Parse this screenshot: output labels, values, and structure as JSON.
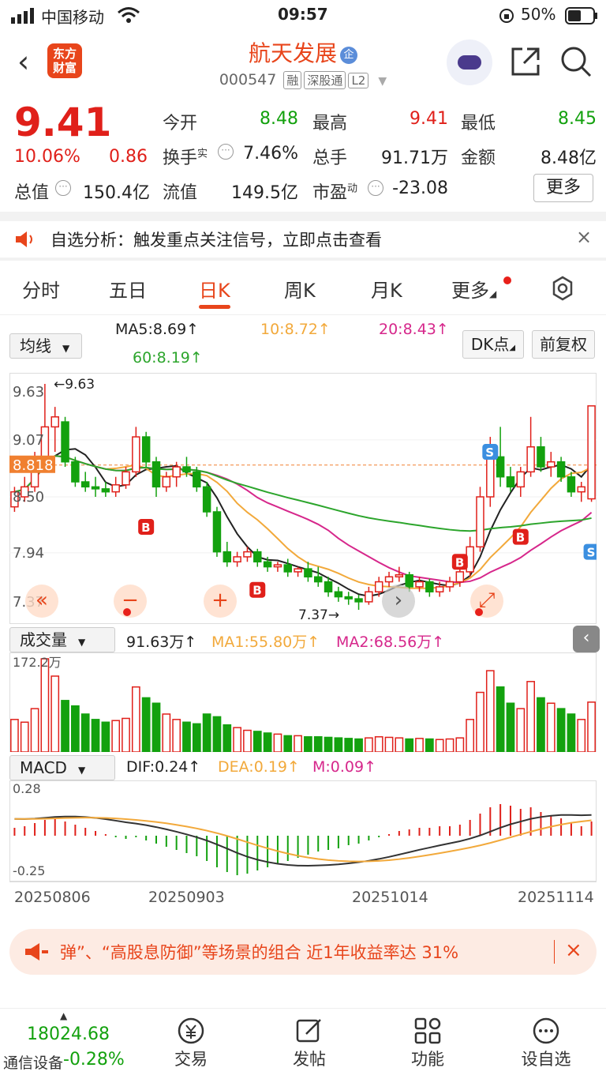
{
  "status_bar": {
    "carrier": "中国移动",
    "time": "09:57",
    "battery": "50%"
  },
  "header": {
    "logo_line1": "东方",
    "logo_line2": "财富",
    "stock_name": "航天发展",
    "badge": "企",
    "stock_code": "000547",
    "tag1": "融",
    "tag2": "深股通",
    "tag3": "L2"
  },
  "quote": {
    "price": "9.41",
    "change_pct": "10.06%",
    "change": "0.86",
    "open_label": "今开",
    "open": "8.48",
    "high_label": "最高",
    "high": "9.41",
    "low_label": "最低",
    "low": "8.45",
    "turnover_label": "换手",
    "turnover_sup": "实",
    "turnover": "7.46%",
    "volume_label": "总手",
    "volume": "91.71万",
    "amount_label": "金额",
    "amount": "8.48亿",
    "mktcap_label": "总值",
    "mktcap": "150.4亿",
    "float_label": "流值",
    "float_cap": "149.5亿",
    "pe_label": "市盈",
    "pe_sup": "动",
    "pe": "-23.08",
    "more": "更多"
  },
  "notice": {
    "text": "自选分析：触发重点关注信号，立即点击查看",
    "close": "×"
  },
  "tabs": [
    "分时",
    "五日",
    "日K",
    "周K",
    "月K",
    "更多"
  ],
  "chart_controls": {
    "ma_select": "均线",
    "ma5": "MA5:8.69↑",
    "ma10": "10:8.72↑",
    "ma20": "20:8.43↑",
    "ma60": "60:8.19↑",
    "dk": "DK点",
    "fq": "前复权",
    "vol_select": "成交量",
    "vol": "91.63万↑",
    "vol_ma1": "MA1:55.80万↑",
    "vol_ma2": "MA2:68.56万↑",
    "macd_select": "MACD",
    "dif": "DIF:0.24↑",
    "dea": "DEA:0.19↑",
    "m": "M:0.09↑"
  },
  "chart_data": {
    "type": "candlestick",
    "y_ticks": [
      "9.63",
      "9.07",
      "8.818",
      "8.50",
      "7.94",
      "7.37"
    ],
    "max_label": "←9.63",
    "min_label": "7.37→",
    "vol_max_label": "172.2万",
    "macd_top_label": "0.28",
    "macd_bottom_label": "-0.25",
    "x_ticks": [
      "20250806",
      "20250903",
      "20251014",
      "20251114"
    ],
    "ohlc": [
      [
        8.4,
        8.6,
        8.35,
        8.55
      ],
      [
        8.5,
        8.7,
        8.45,
        8.6
      ],
      [
        8.6,
        8.95,
        8.55,
        8.9
      ],
      [
        8.9,
        9.63,
        8.85,
        9.2
      ],
      [
        9.2,
        9.4,
        8.95,
        9.3
      ],
      [
        9.25,
        9.3,
        8.8,
        8.85
      ],
      [
        8.85,
        8.9,
        8.6,
        8.65
      ],
      [
        8.65,
        8.75,
        8.55,
        8.6
      ],
      [
        8.6,
        8.7,
        8.5,
        8.58
      ],
      [
        8.58,
        8.65,
        8.5,
        8.55
      ],
      [
        8.55,
        8.7,
        8.5,
        8.62
      ],
      [
        8.62,
        8.8,
        8.58,
        8.75
      ],
      [
        8.75,
        9.2,
        8.7,
        9.1
      ],
      [
        9.1,
        9.15,
        8.8,
        8.85
      ],
      [
        8.85,
        8.9,
        8.5,
        8.6
      ],
      [
        8.6,
        8.75,
        8.55,
        8.7
      ],
      [
        8.7,
        8.85,
        8.6,
        8.8
      ],
      [
        8.8,
        8.9,
        8.7,
        8.75
      ],
      [
        8.75,
        8.8,
        8.55,
        8.6
      ],
      [
        8.6,
        8.65,
        8.3,
        8.35
      ],
      [
        8.35,
        8.4,
        7.9,
        7.95
      ],
      [
        7.95,
        8.05,
        7.8,
        7.85
      ],
      [
        7.85,
        7.95,
        7.8,
        7.9
      ],
      [
        7.9,
        8.0,
        7.85,
        7.95
      ],
      [
        7.95,
        7.98,
        7.8,
        7.85
      ],
      [
        7.85,
        7.9,
        7.75,
        7.8
      ],
      [
        7.8,
        7.85,
        7.75,
        7.82
      ],
      [
        7.82,
        7.88,
        7.7,
        7.75
      ],
      [
        7.75,
        7.8,
        7.7,
        7.78
      ],
      [
        7.78,
        7.85,
        7.65,
        7.7
      ],
      [
        7.7,
        7.8,
        7.6,
        7.65
      ],
      [
        7.65,
        7.7,
        7.5,
        7.55
      ],
      [
        7.55,
        7.6,
        7.45,
        7.5
      ],
      [
        7.5,
        7.55,
        7.42,
        7.48
      ],
      [
        7.48,
        7.52,
        7.37,
        7.45
      ],
      [
        7.45,
        7.6,
        7.42,
        7.55
      ],
      [
        7.55,
        7.7,
        7.5,
        7.65
      ],
      [
        7.65,
        7.75,
        7.6,
        7.7
      ],
      [
        7.7,
        7.8,
        7.65,
        7.72
      ],
      [
        7.72,
        7.75,
        7.55,
        7.6
      ],
      [
        7.6,
        7.7,
        7.55,
        7.65
      ],
      [
        7.65,
        7.68,
        7.5,
        7.55
      ],
      [
        7.55,
        7.65,
        7.5,
        7.6
      ],
      [
        7.6,
        7.7,
        7.55,
        7.65
      ],
      [
        7.65,
        7.8,
        7.6,
        7.75
      ],
      [
        7.75,
        8.1,
        7.7,
        8.0
      ],
      [
        8.0,
        8.6,
        7.95,
        8.5
      ],
      [
        8.5,
        9.1,
        8.4,
        8.9
      ],
      [
        8.9,
        9.2,
        8.6,
        8.7
      ],
      [
        8.7,
        8.8,
        8.55,
        8.6
      ],
      [
        8.6,
        8.8,
        8.5,
        8.75
      ],
      [
        8.75,
        9.3,
        8.7,
        9.0
      ],
      [
        9.0,
        9.1,
        8.75,
        8.8
      ],
      [
        8.8,
        8.95,
        8.7,
        8.85
      ],
      [
        8.85,
        8.9,
        8.65,
        8.7
      ],
      [
        8.7,
        8.75,
        8.5,
        8.55
      ],
      [
        8.55,
        8.65,
        8.45,
        8.6
      ],
      [
        8.48,
        9.41,
        8.45,
        9.41
      ]
    ],
    "volume": [
      60,
      55,
      80,
      172,
      140,
      95,
      85,
      70,
      60,
      55,
      58,
      62,
      120,
      100,
      90,
      70,
      60,
      55,
      52,
      70,
      65,
      50,
      45,
      40,
      38,
      35,
      33,
      30,
      30,
      28,
      28,
      27,
      26,
      25,
      24,
      26,
      28,
      27,
      26,
      24,
      25,
      24,
      23,
      24,
      26,
      60,
      110,
      150,
      120,
      90,
      80,
      130,
      100,
      90,
      80,
      70,
      60,
      92
    ],
    "vol_up": [
      true,
      true,
      true,
      true,
      true,
      false,
      false,
      false,
      false,
      false,
      true,
      true,
      true,
      false,
      false,
      true,
      true,
      false,
      false,
      false,
      false,
      false,
      true,
      true,
      false,
      false,
      true,
      false,
      true,
      false,
      false,
      false,
      false,
      false,
      false,
      true,
      true,
      true,
      true,
      false,
      true,
      false,
      true,
      true,
      true,
      true,
      true,
      true,
      false,
      false,
      true,
      true,
      false,
      true,
      false,
      false,
      true,
      true
    ],
    "macd_hist": [
      0.05,
      0.06,
      0.08,
      0.1,
      0.11,
      0.09,
      0.07,
      0.05,
      0.03,
      0.01,
      -0.01,
      -0.02,
      -0.01,
      -0.03,
      -0.05,
      -0.07,
      -0.09,
      -0.11,
      -0.13,
      -0.16,
      -0.2,
      -0.23,
      -0.25,
      -0.24,
      -0.22,
      -0.2,
      -0.18,
      -0.16,
      -0.14,
      -0.12,
      -0.1,
      -0.09,
      -0.08,
      -0.06,
      -0.05,
      -0.03,
      -0.01,
      0.01,
      0.03,
      0.04,
      0.05,
      0.05,
      0.06,
      0.06,
      0.07,
      0.1,
      0.14,
      0.18,
      0.2,
      0.19,
      0.17,
      0.18,
      0.15,
      0.13,
      0.11,
      0.08,
      0.06,
      0.09
    ]
  },
  "ad": {
    "text": "弹”、“高股息防御”等场景的组合 近1年收益率达 31%",
    "close": "×"
  },
  "bottom_nav": {
    "index_value": "18024.68",
    "index_name": "通信设备",
    "index_change": "-0.28%",
    "items": [
      "交易",
      "发帖",
      "功能",
      "设自选"
    ]
  }
}
